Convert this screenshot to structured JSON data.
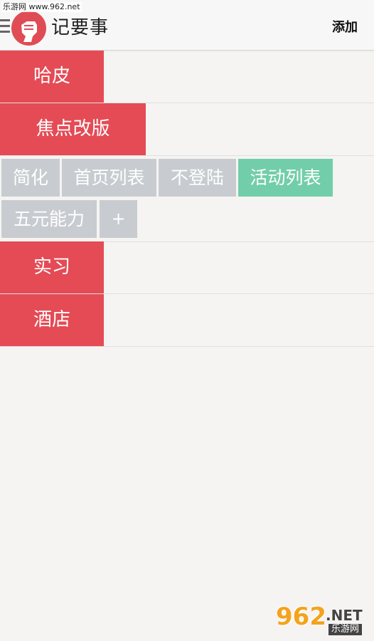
{
  "watermark": {
    "top_text": "乐游网 www.962.net",
    "bottom_logo_number": "962",
    "bottom_logo_domain": ".NET",
    "bottom_logo_sub": "乐游网"
  },
  "header": {
    "app_title": "记要事",
    "add_label": "添加"
  },
  "categories": [
    {
      "label": "哈皮"
    },
    {
      "label": "焦点改版"
    },
    {
      "label": "实习"
    },
    {
      "label": "酒店"
    }
  ],
  "tags": [
    {
      "label": "简化",
      "active": false
    },
    {
      "label": "首页列表",
      "active": false
    },
    {
      "label": "不登陆",
      "active": false
    },
    {
      "label": "活动列表",
      "active": true
    },
    {
      "label": "五元能力",
      "active": false
    },
    {
      "label": "+",
      "active": false
    }
  ],
  "colors": {
    "category_red": "#e44b55",
    "tag_gray": "#c8ccd0",
    "tag_active_green": "#72ceaa",
    "background": "#f5f4f2"
  }
}
